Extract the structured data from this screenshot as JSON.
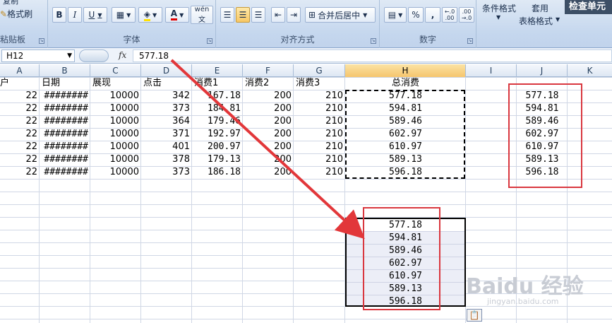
{
  "ribbon": {
    "clipboard": {
      "copy_label": "复制",
      "painter_label": "格式刷",
      "group_label": "粘贴板"
    },
    "font": {
      "group_label": "字体",
      "bold": "B",
      "italic": "I",
      "underline": "U",
      "font_color_letter": "A",
      "phonetic": "wén"
    },
    "alignment": {
      "group_label": "对齐方式",
      "merge_label": "合并后居中"
    },
    "number": {
      "group_label": "数字",
      "percent": "%",
      "comma": ",",
      "inc_decimal": "←.0 .00",
      "dec_decimal": ".00 →.0"
    },
    "styles": {
      "conditional_label": "条件格式",
      "apply_label": "套用",
      "table_format_label": "表格格式"
    },
    "check_button": "检查单元"
  },
  "formula_bar": {
    "name_box": "H12",
    "fx": "fx",
    "value": "577.18"
  },
  "columns": [
    "A",
    "B",
    "C",
    "D",
    "E",
    "F",
    "G",
    "H",
    "I",
    "J",
    "K"
  ],
  "selected_column": "H",
  "headers": {
    "A": "户",
    "B": "日期",
    "C": "展现",
    "D": "点击",
    "E": "消费1",
    "F": "消费2",
    "G": "消费3",
    "H": "总消费"
  },
  "rows": [
    {
      "a": "22",
      "b": "########",
      "c": "10000",
      "d": "342",
      "e": "167.18",
      "f": "200",
      "g": "210",
      "h": "577.18",
      "j": "577.18"
    },
    {
      "a": "22",
      "b": "########",
      "c": "10000",
      "d": "373",
      "e": "184.81",
      "f": "200",
      "g": "210",
      "h": "594.81",
      "j": "594.81"
    },
    {
      "a": "22",
      "b": "########",
      "c": "10000",
      "d": "364",
      "e": "179.46",
      "f": "200",
      "g": "210",
      "h": "589.46",
      "j": "589.46"
    },
    {
      "a": "22",
      "b": "########",
      "c": "10000",
      "d": "371",
      "e": "192.97",
      "f": "200",
      "g": "210",
      "h": "602.97",
      "j": "602.97"
    },
    {
      "a": "22",
      "b": "########",
      "c": "10000",
      "d": "401",
      "e": "200.97",
      "f": "200",
      "g": "210",
      "h": "610.97",
      "j": "610.97"
    },
    {
      "a": "22",
      "b": "########",
      "c": "10000",
      "d": "378",
      "e": "179.13",
      "f": "200",
      "g": "210",
      "h": "589.13",
      "j": "589.13"
    },
    {
      "a": "22",
      "b": "########",
      "c": "10000",
      "d": "373",
      "e": "186.18",
      "f": "200",
      "g": "210",
      "h": "596.18",
      "j": "596.18"
    }
  ],
  "pasted_values": [
    "577.18",
    "594.81",
    "589.46",
    "602.97",
    "610.97",
    "589.13",
    "596.18"
  ],
  "watermark": {
    "main": "Baidu 经验",
    "sub": "jingyan.baidu.com"
  },
  "colors": {
    "annotation_red": "#d9373f",
    "selection_header": "#f5c56d"
  }
}
